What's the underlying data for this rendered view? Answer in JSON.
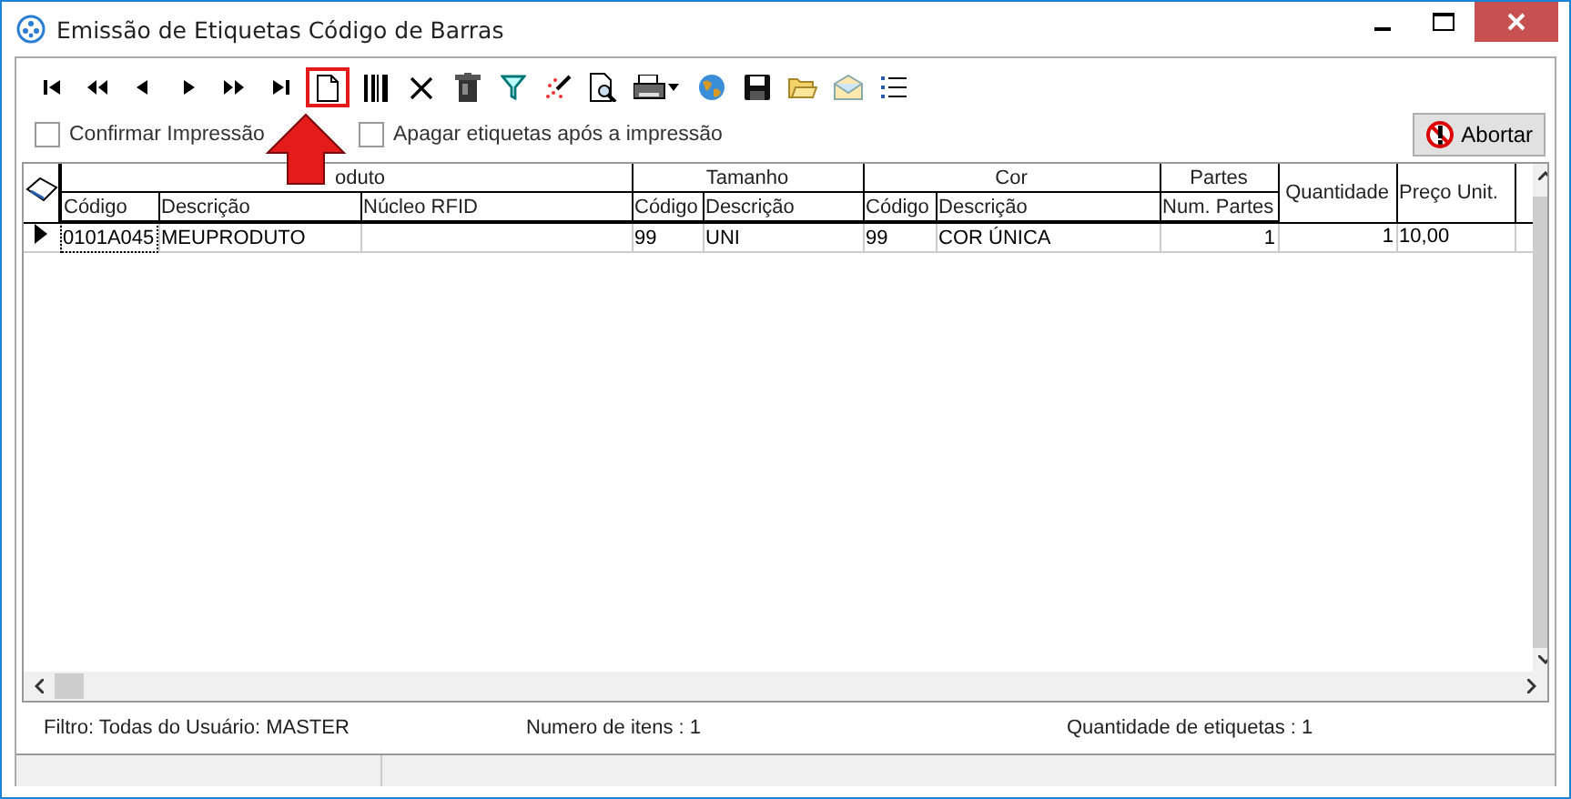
{
  "window": {
    "title": "Emissão de Etiquetas Código de Barras"
  },
  "toolbar": [
    {
      "kind": "first",
      "highlighted": false
    },
    {
      "kind": "prev-page",
      "highlighted": false
    },
    {
      "kind": "prev",
      "highlighted": false
    },
    {
      "kind": "next",
      "highlighted": false
    },
    {
      "kind": "next-page",
      "highlighted": false
    },
    {
      "kind": "last",
      "highlighted": false
    },
    {
      "kind": "new",
      "highlighted": true
    },
    {
      "kind": "barcode",
      "highlighted": false
    },
    {
      "kind": "delete",
      "highlighted": false
    },
    {
      "kind": "trash",
      "highlighted": false
    },
    {
      "kind": "filter",
      "highlighted": false
    },
    {
      "kind": "wand",
      "highlighted": false
    },
    {
      "kind": "preview",
      "highlighted": false
    },
    {
      "kind": "print",
      "highlighted": false
    },
    {
      "kind": "globe",
      "highlighted": false
    },
    {
      "kind": "save",
      "highlighted": false
    },
    {
      "kind": "folder",
      "highlighted": false
    },
    {
      "kind": "mail",
      "highlighted": false
    },
    {
      "kind": "list",
      "highlighted": false
    }
  ],
  "options": [
    {
      "label": "Confirmar Impressão",
      "checked": false
    },
    {
      "label": "Apagar etiquetas após a impressão",
      "checked": false
    }
  ],
  "abort_button": {
    "label": "Abortar"
  },
  "table": {
    "groups": [
      {
        "label": "oduto"
      },
      {
        "label": "Tamanho"
      },
      {
        "label": "Cor"
      },
      {
        "label": "Partes"
      }
    ],
    "columns": [
      {
        "label": "Código"
      },
      {
        "label": "Descrição"
      },
      {
        "label": "Núcleo RFID"
      },
      {
        "label": "Código"
      },
      {
        "label": "Descrição"
      },
      {
        "label": "Código"
      },
      {
        "label": "Descrição"
      },
      {
        "label": "Num. Partes"
      },
      {
        "label": "Quantidade"
      },
      {
        "label": "Preço Unit."
      }
    ],
    "rows": [
      {
        "current": true,
        "cells": [
          "0101A045",
          "MEUPRODUTO",
          "",
          "99",
          "UNI",
          "99",
          "COR ÚNICA",
          "1",
          "1",
          "10,00"
        ]
      }
    ]
  },
  "status": {
    "filter": "Filtro: Todas do Usuário: MASTER",
    "items_count": "Numero de itens :  1",
    "labels_count": "Quantidade de etiquetas :  1"
  }
}
